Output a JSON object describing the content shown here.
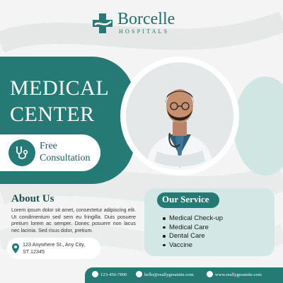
{
  "brand": {
    "name": "Borcelle",
    "subtitle": "HOSPITALS"
  },
  "hero": {
    "title_line1": "MEDICAL",
    "title_line2": "CENTER"
  },
  "consultation": {
    "icon": "stethoscope-icon",
    "line1": "Free",
    "line2": "Consultation"
  },
  "about": {
    "title": "About Us",
    "text": "Lorem ipsum dolor sit amet, consectetur adipiscing elit. Ut condimentum sed sem eu fringilla. Duis posuere pretium lorem ac semper. Donec posuere non lacus nec lacinia. Sed risus dolor, pretium."
  },
  "address": {
    "icon": "location-pin-icon",
    "line1": "123 Anywhere St., Any City,",
    "line2": "ST 12345"
  },
  "services": {
    "title": "Our Service",
    "items": [
      "Medical Check-up",
      "Medical Care",
      "Dental Care",
      "Vaccine"
    ]
  },
  "footer": {
    "phone": "123-456-7890",
    "email": "hello@reallygreatsite.com",
    "website": "www.reallygreatsite.com"
  },
  "colors": {
    "teal": "#267a75",
    "light_teal": "#d3e8e4",
    "background": "#f3f4f3"
  }
}
